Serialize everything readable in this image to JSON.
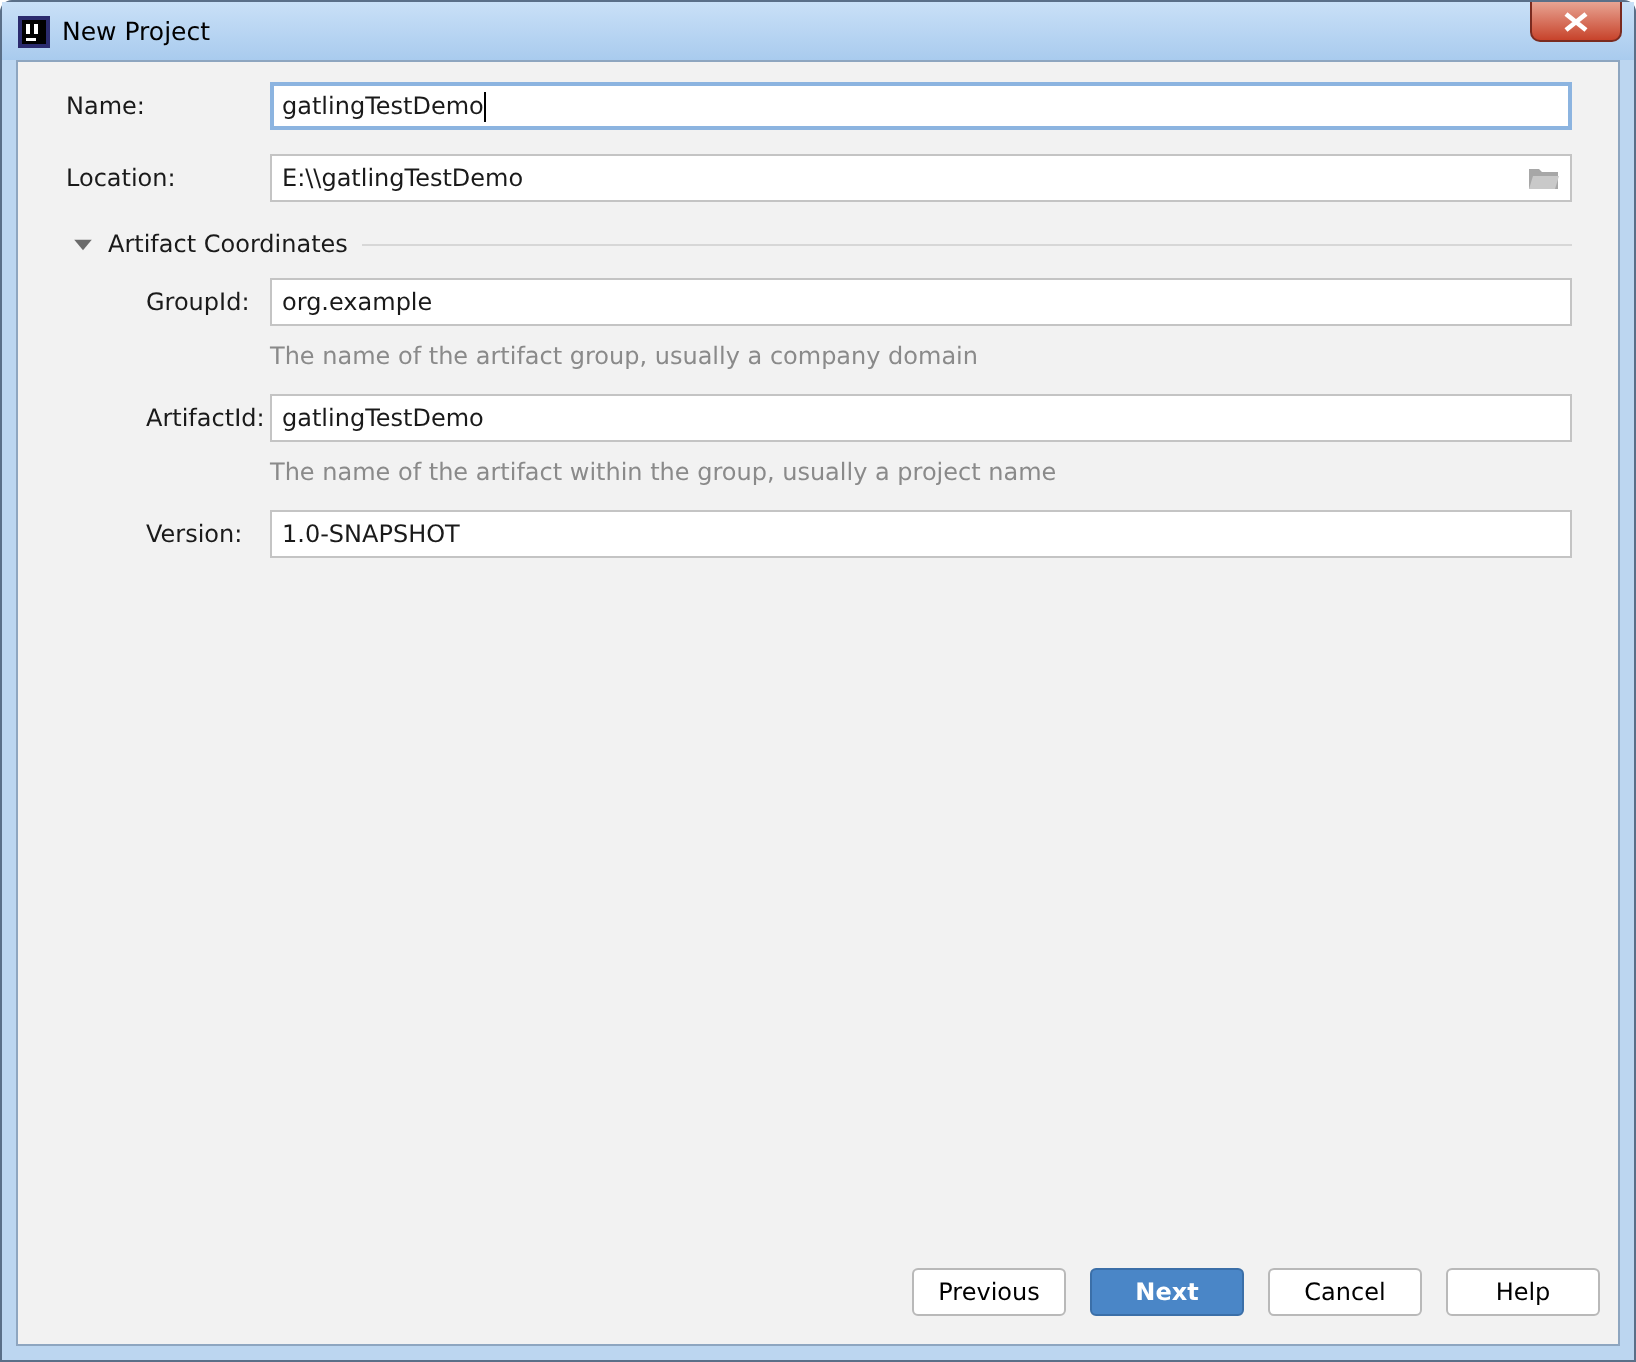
{
  "window": {
    "title": "New Project"
  },
  "name": {
    "label": "Name:",
    "value": "gatlingTestDemo",
    "focused": true
  },
  "location": {
    "label": "Location:",
    "value": "E:\\\\gatlingTestDemo"
  },
  "section": {
    "title": "Artifact Coordinates",
    "expanded": true,
    "fields": [
      {
        "label": "GroupId:",
        "value": "org.example",
        "hint": "The name of the artifact group, usually a company domain"
      },
      {
        "label": "ArtifactId:",
        "value": "gatlingTestDemo",
        "hint": "The name of the artifact within the group, usually a project name"
      },
      {
        "label": "Version:",
        "value": "1.0-SNAPSHOT"
      }
    ]
  },
  "buttons": [
    {
      "label": "Previous",
      "kind": "normal"
    },
    {
      "label": "Next",
      "kind": "default"
    },
    {
      "label": "Cancel",
      "kind": "normal"
    },
    {
      "label": "Help",
      "kind": "normal"
    }
  ]
}
